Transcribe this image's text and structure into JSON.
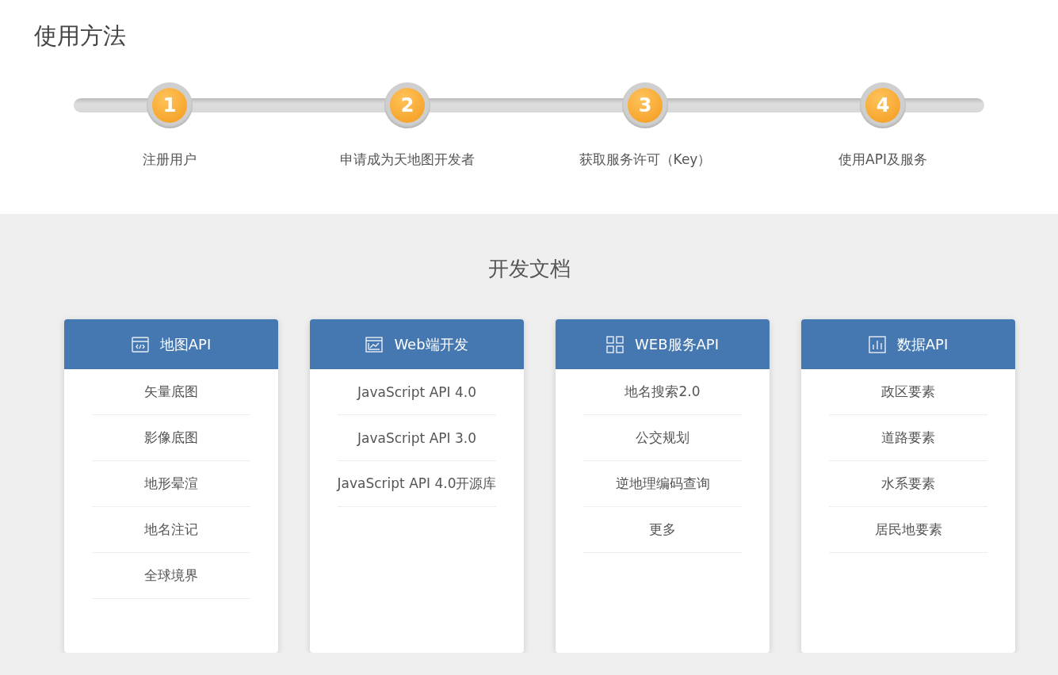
{
  "usage": {
    "title": "使用方法",
    "steps": [
      {
        "number": "1",
        "label": "注册用户"
      },
      {
        "number": "2",
        "label": "申请成为天地图开发者"
      },
      {
        "number": "3",
        "label": "获取服务许可（Key）"
      },
      {
        "number": "4",
        "label": "使用API及服务"
      }
    ]
  },
  "docs": {
    "title": "开发文档",
    "cards": [
      {
        "title": "地图API",
        "kind": "code",
        "items": [
          "矢量底图",
          "影像底图",
          "地形晕渲",
          "地名注记",
          "全球境界"
        ]
      },
      {
        "title": "Web端开发",
        "kind": "chart",
        "items": [
          "JavaScript API 4.0",
          "JavaScript API 3.0",
          "JavaScript API 4.0开源库"
        ]
      },
      {
        "title": "WEB服务API",
        "kind": "grid",
        "items": [
          "地名搜索2.0",
          "公交规划",
          "逆地理编码查询",
          "更多"
        ]
      },
      {
        "title": "数据API",
        "kind": "bars",
        "items": [
          "政区要素",
          "道路要素",
          "水系要素",
          "居民地要素"
        ]
      }
    ]
  }
}
